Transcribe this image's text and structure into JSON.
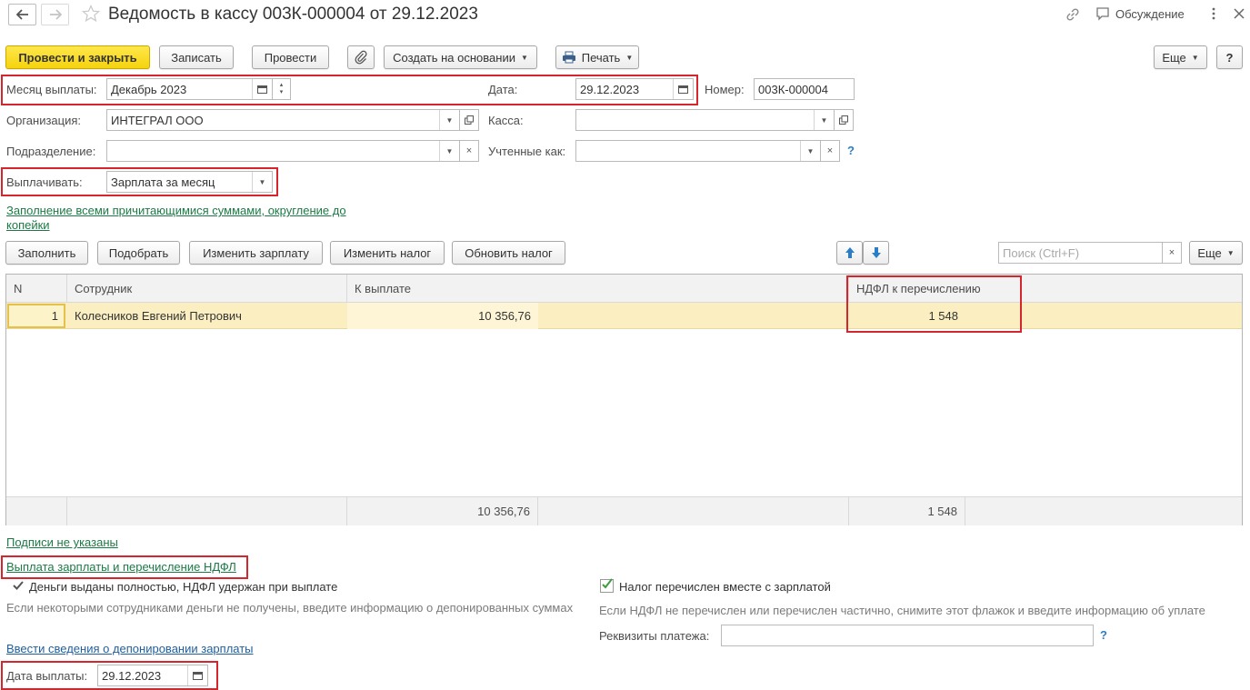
{
  "window": {
    "title": "Ведомость в кассу 003К-000004 от 29.12.2023",
    "discussion_label": "Обсуждение"
  },
  "toolbar": {
    "post_close": "Провести и закрыть",
    "write": "Записать",
    "post": "Провести",
    "create_based": "Создать на основании",
    "print": "Печать",
    "more": "Еще",
    "help": "?"
  },
  "form": {
    "month_label": "Месяц выплаты:",
    "month_value": "Декабрь 2023",
    "date_label": "Дата:",
    "date_value": "29.12.2023",
    "number_label": "Номер:",
    "number_value": "003К-000004",
    "org_label": "Организация:",
    "org_value": "ИНТЕГРАЛ ООО",
    "cash_label": "Касса:",
    "cash_value": "",
    "dept_label": "Подразделение:",
    "dept_value": "",
    "counted_label": "Учтенные как:",
    "counted_value": "",
    "pay_label": "Выплачивать:",
    "pay_value": "Зарплата за месяц",
    "fill_link_line1": "Заполнение всеми причитающимися суммами, округление до",
    "fill_link_line2": "копейки"
  },
  "table_toolbar": {
    "fill": "Заполнить",
    "pick": "Подобрать",
    "change_salary": "Изменить зарплату",
    "change_tax": "Изменить налог",
    "update_tax": "Обновить налог",
    "search_placeholder": "Поиск (Ctrl+F)",
    "more": "Еще"
  },
  "table": {
    "headers": {
      "n": "N",
      "employee": "Сотрудник",
      "to_pay": "К выплате",
      "ndfl": "НДФЛ к перечислению"
    },
    "rows": [
      {
        "n": "1",
        "employee": "Колесников Евгений Петрович",
        "to_pay": "10 356,76",
        "ndfl": "1 548"
      }
    ],
    "totals": {
      "to_pay": "10 356,76",
      "ndfl": "1 548"
    }
  },
  "bottom": {
    "signatures_link": "Подписи не указаны",
    "payout_link": "Выплата зарплаты и перечисление НДФЛ",
    "money_status": "Деньги выданы полностью, НДФЛ удержан при выплате",
    "money_note": "Если некоторыми сотрудниками деньги не получены, введите информацию о депонированных суммах",
    "tax_checkbox_label": "Налог перечислен вместе с зарплатой",
    "tax_checked": true,
    "tax_note": "Если НДФЛ не перечислен или перечислен частично, снимите этот флажок и введите информацию об уплате",
    "payment_details_label": "Реквизиты платежа:",
    "payment_details_value": "",
    "deposit_link": "Ввести сведения о депонировании зарплаты",
    "pay_date_label": "Дата выплаты:",
    "pay_date_value": "29.12.2023"
  },
  "colors": {
    "primary_button": "#f5d30d",
    "highlight_box": "#d5262e",
    "link": "#1c7a45",
    "row_selected": "#fbefc2",
    "arrow_button": "#2a7ec6"
  }
}
